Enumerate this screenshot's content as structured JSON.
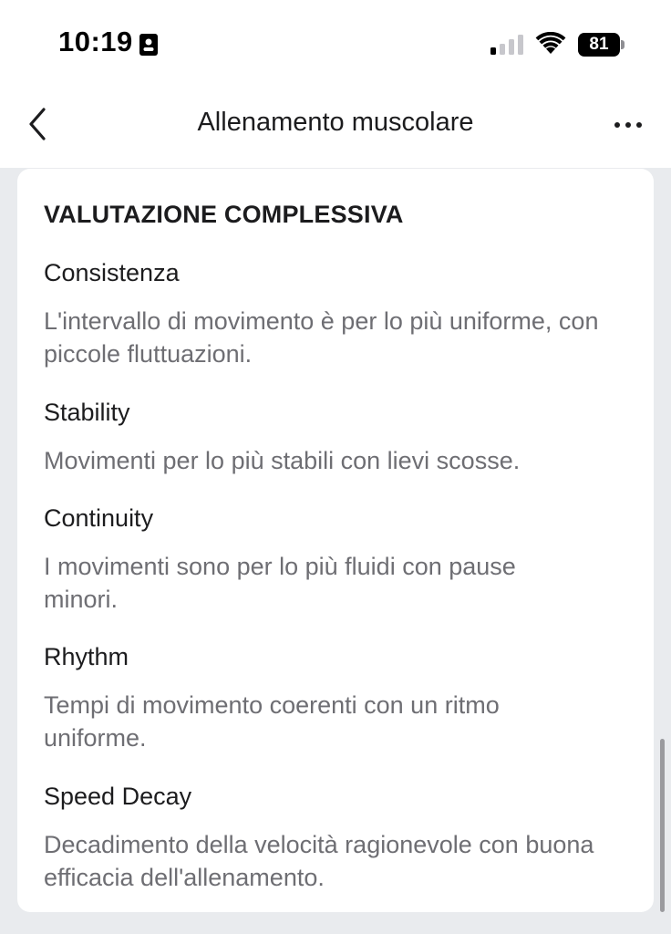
{
  "status_bar": {
    "time": "10:19",
    "battery_level": "81",
    "cellular_bars_active": 1,
    "cellular_bars_total": 4
  },
  "nav": {
    "title": "Allenamento muscolare",
    "back_icon": "chevron-left-icon",
    "more_icon": "ellipsis-icon"
  },
  "card": {
    "section_title": "VALUTAZIONE COMPLESSIVA",
    "metrics": [
      {
        "name": "Consistenza",
        "description": "L'intervallo di movimento è per lo più uniforme, con piccole fluttuazioni."
      },
      {
        "name": "Stability",
        "description": "Movimenti per lo più stabili con lievi scosse."
      },
      {
        "name": "Continuity",
        "description": "I movimenti sono per lo più fluidi con pause minori."
      },
      {
        "name": "Rhythm",
        "description": "Tempi di movimento coerenti con un ritmo uniforme."
      },
      {
        "name": "Speed Decay",
        "description": "Decadimento della velocità ragionevole con buona efficacia dell'allenamento."
      }
    ]
  },
  "colors": {
    "background": "#e9ebee",
    "card": "#ffffff",
    "text_primary": "#1c1c1e",
    "text_secondary": "#6e6e73"
  }
}
